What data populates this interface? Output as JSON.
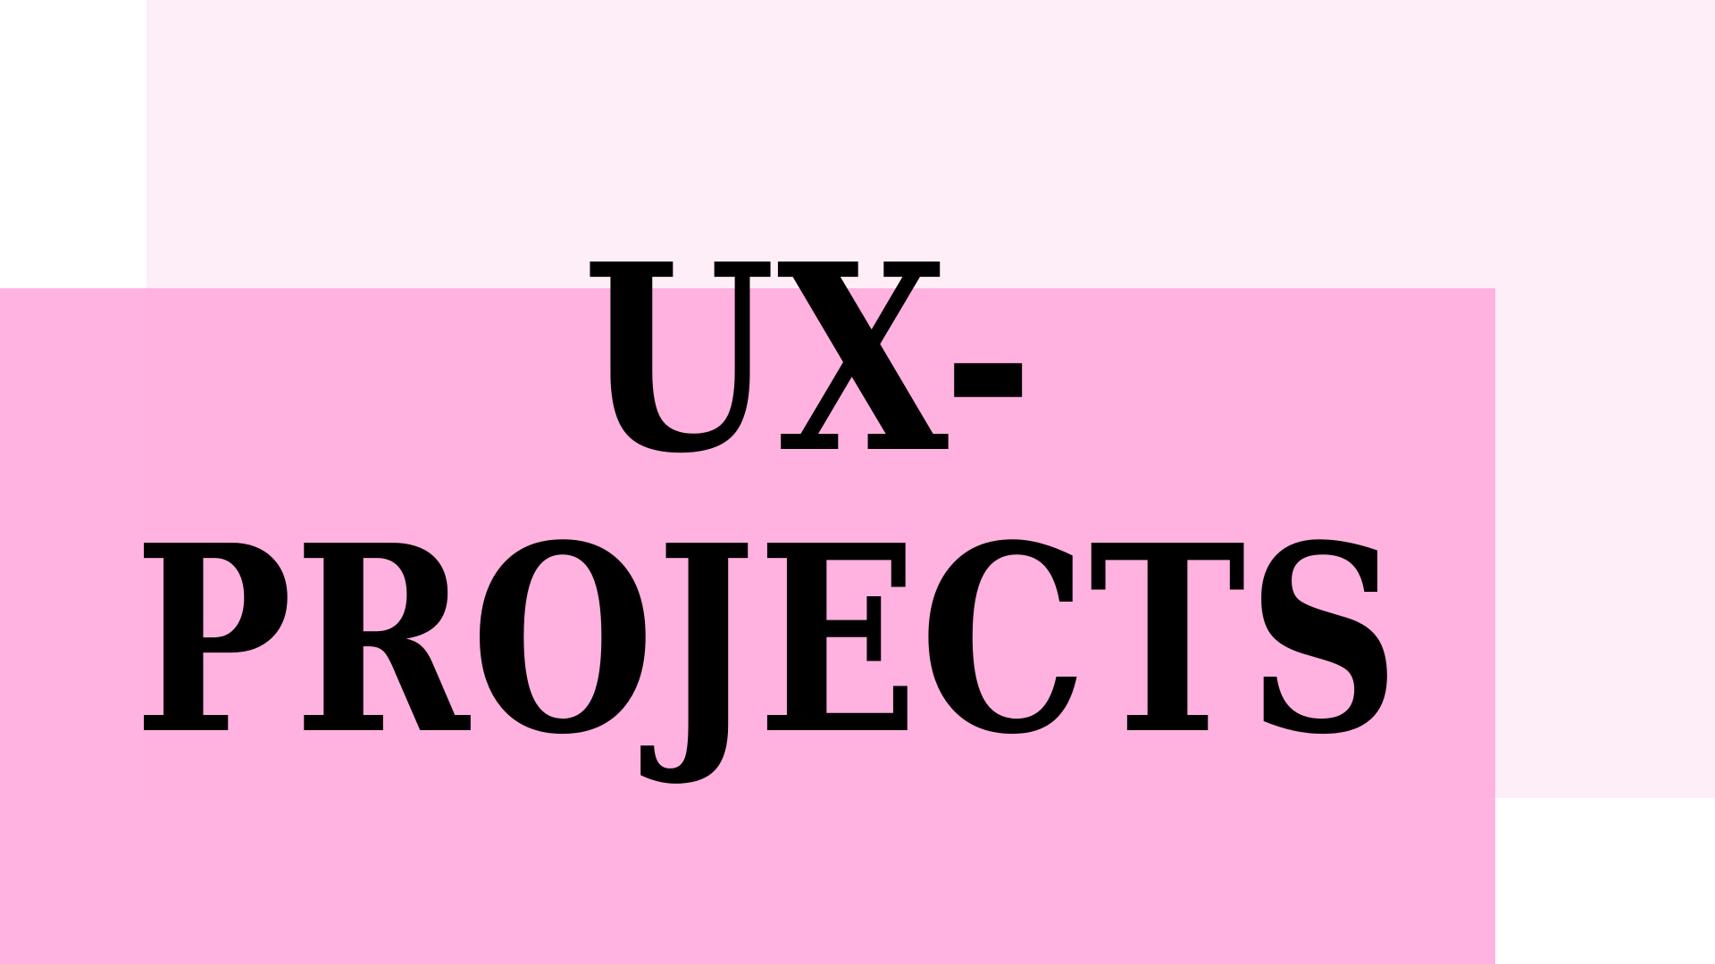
{
  "colors": {
    "background": "#ffffff",
    "panel_light": "#fdeef7",
    "panel_pink": "#ffa9dc",
    "text": "#000000"
  },
  "title": {
    "line1": "UX-",
    "line2": "PROJECTS"
  }
}
